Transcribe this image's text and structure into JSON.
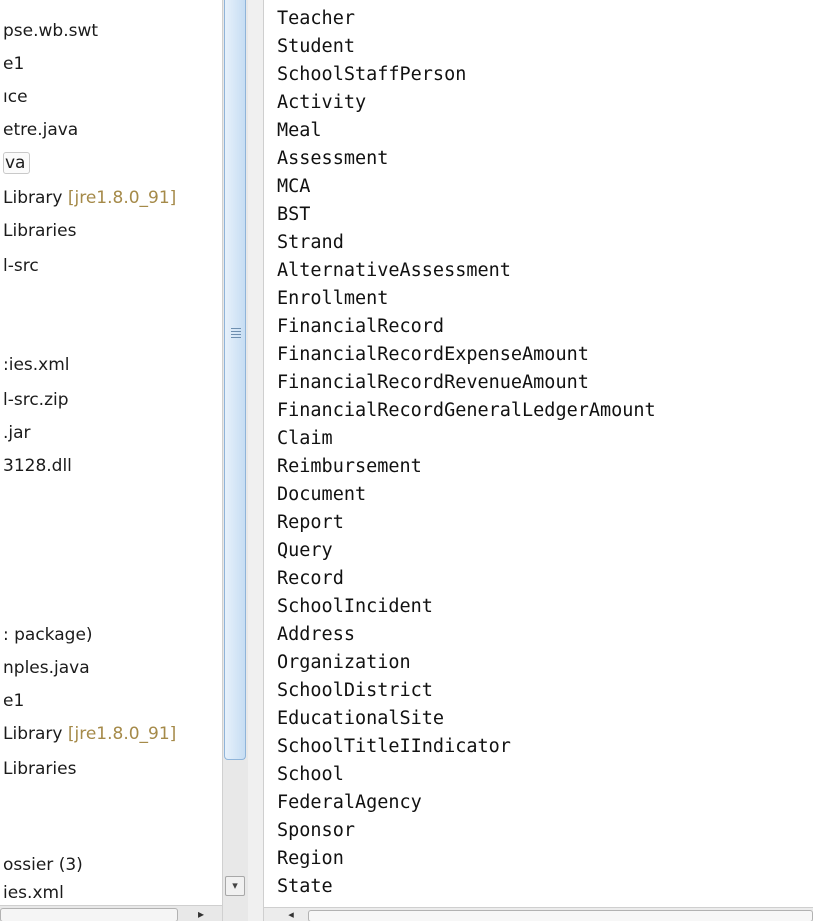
{
  "explorer": {
    "items": [
      {
        "text": "pse.wb.swt"
      },
      {
        "text": "e1"
      },
      {
        "text": "ıce"
      },
      {
        "text": "etre.java"
      },
      {
        "text": "va",
        "selected": true
      },
      {
        "text": " Library ",
        "decoration": "[jre1.8.0_91]"
      },
      {
        "text": " Libraries"
      },
      {
        "text": "l-src"
      },
      {
        "text": ":ies.xml"
      },
      {
        "text": "l-src.zip"
      },
      {
        "text": ".jar"
      },
      {
        "text": "3128.dll"
      },
      {
        "text": ": package)"
      },
      {
        "text": "nples.java"
      },
      {
        "text": "e1"
      },
      {
        "text": " Library ",
        "decoration": "[jre1.8.0_91]"
      },
      {
        "text": " Libraries"
      },
      {
        "text": "ossier (3)"
      },
      {
        "text": "ies.xml"
      }
    ],
    "scroll_down_glyph": "▾",
    "hscroll_right_glyph": "▸"
  },
  "editor": {
    "lines": [
      "Teacher",
      "Student",
      "SchoolStaffPerson",
      "Activity",
      "Meal",
      "Assessment",
      "MCA",
      "BST",
      "Strand",
      "AlternativeAssessment",
      "Enrollment",
      "FinancialRecord",
      "FinancialRecordExpenseAmount",
      "FinancialRecordRevenueAmount",
      "FinancialRecordGeneralLedgerAmount",
      "Claim",
      "Reimbursement",
      "Document",
      "Report",
      "Query",
      "Record",
      "SchoolIncident",
      "Address",
      "Organization",
      "SchoolDistrict",
      "EducationalSite",
      "SchoolTitleIIndicator",
      "School",
      "FederalAgency",
      "Sponsor",
      "Region",
      "State"
    ],
    "hscroll_left_glyph": "◂"
  },
  "colors": {
    "decoration": "#a58a49",
    "scroll_thumb": "#c6ddf3"
  }
}
